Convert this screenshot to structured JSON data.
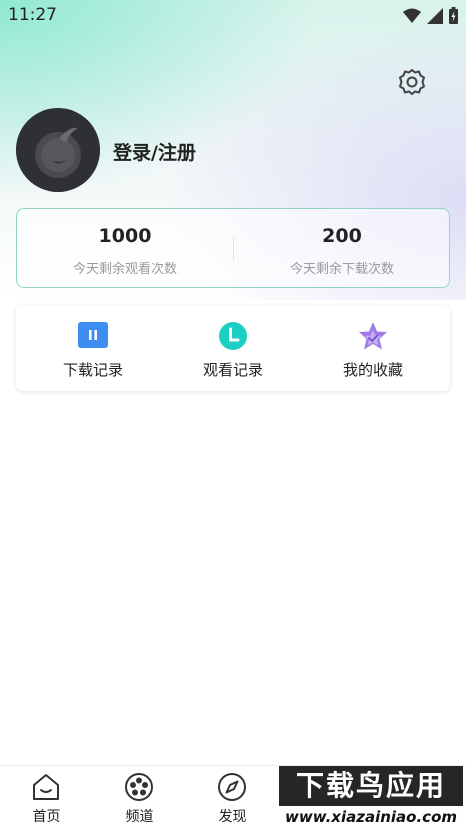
{
  "status_bar": {
    "time": "11:27"
  },
  "profile": {
    "login_label": "登录/注册"
  },
  "quota": [
    {
      "value": "1000",
      "label": "今天剩余观看次数"
    },
    {
      "value": "200",
      "label": "今天剩余下载次数"
    }
  ],
  "shortcuts": [
    {
      "label": "下载记录",
      "icon": "download-record-icon",
      "color": "#3d8ef0"
    },
    {
      "label": "观看记录",
      "icon": "clock-icon",
      "color": "#1ccfc4"
    },
    {
      "label": "我的收藏",
      "icon": "star-icon",
      "color": "#a07ae8"
    }
  ],
  "tabs": [
    {
      "label": "首页",
      "icon": "home-icon"
    },
    {
      "label": "频道",
      "icon": "film-reel-icon"
    },
    {
      "label": "发现",
      "icon": "compass-icon"
    }
  ],
  "watermark": {
    "title": "下载鸟应用",
    "url": "www.xiazainiao.com"
  },
  "colors": {
    "accent_border": "#8fd6c9",
    "text_primary": "#222222",
    "text_secondary": "#9a9a9a"
  }
}
